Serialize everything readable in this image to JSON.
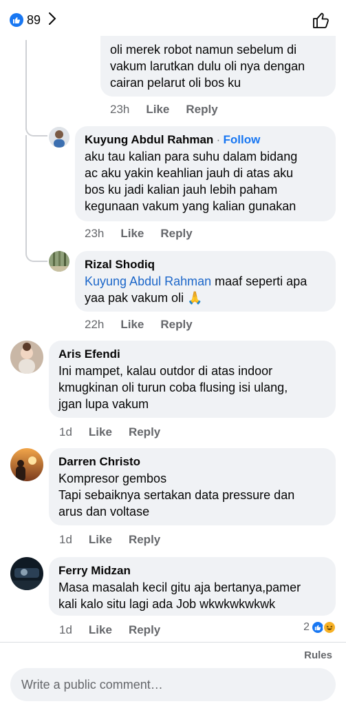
{
  "header": {
    "reaction_count": "89",
    "like_icon": "like-icon",
    "chevron_icon": "chevron-right-icon",
    "thumb_icon": "thumbs-up-outline-icon"
  },
  "comments": [
    {
      "lines": [
        "oli merek robot namun sebelum di",
        "vakum larutkan dulu oli nya dengan",
        "cairan pelarut oli  bos ku"
      ],
      "time": "23h",
      "like": "Like",
      "reply": "Reply"
    },
    {
      "name": "Kuyung Abdul Rahman",
      "sep": " · ",
      "follow": "Follow",
      "lines": [
        "aku tau kalian para suhu dalam bidang",
        "ac aku yakin keahlian jauh di atas aku",
        "bos ku jadi kalian jauh lebih paham",
        "kegunaan vakum yang kalian gunakan"
      ],
      "time": "23h",
      "like": "Like",
      "reply": "Reply"
    },
    {
      "name": "Rizal Shodiq",
      "mention": "Kuyung Abdul Rahman",
      "line1_rest": " maaf seperti apa",
      "line2": "yaa pak vakum oli 🙏",
      "time": "22h",
      "like": "Like",
      "reply": "Reply"
    },
    {
      "name": "Aris Efendi",
      "lines": [
        "Ini mampet, kalau outdor di atas indoor",
        "kmugkinan oli turun coba flusing isi ulang,",
        "jgan lupa vakum"
      ],
      "time": "1d",
      "like": "Like",
      "reply": "Reply"
    },
    {
      "name": "Darren Christo",
      "lines": [
        "Kompresor gembos",
        "Tapi sebaiknya sertakan data pressure dan",
        "arus dan voltase"
      ],
      "time": "1d",
      "like": "Like",
      "reply": "Reply"
    },
    {
      "name": "Ferry Midzan",
      "lines": [
        "Masa masalah kecil gitu aja bertanya,pamer",
        "kali kalo situ lagi ada Job wkwkwkwkwk"
      ],
      "time": "1d",
      "like": "Like",
      "reply": "Reply",
      "reactions": "2"
    }
  ],
  "footer": {
    "rules": "Rules",
    "placeholder": "Write a public comment…"
  },
  "colors": {
    "accent": "#1877f2",
    "bubble": "#f0f2f5",
    "muted": "#65676b"
  }
}
